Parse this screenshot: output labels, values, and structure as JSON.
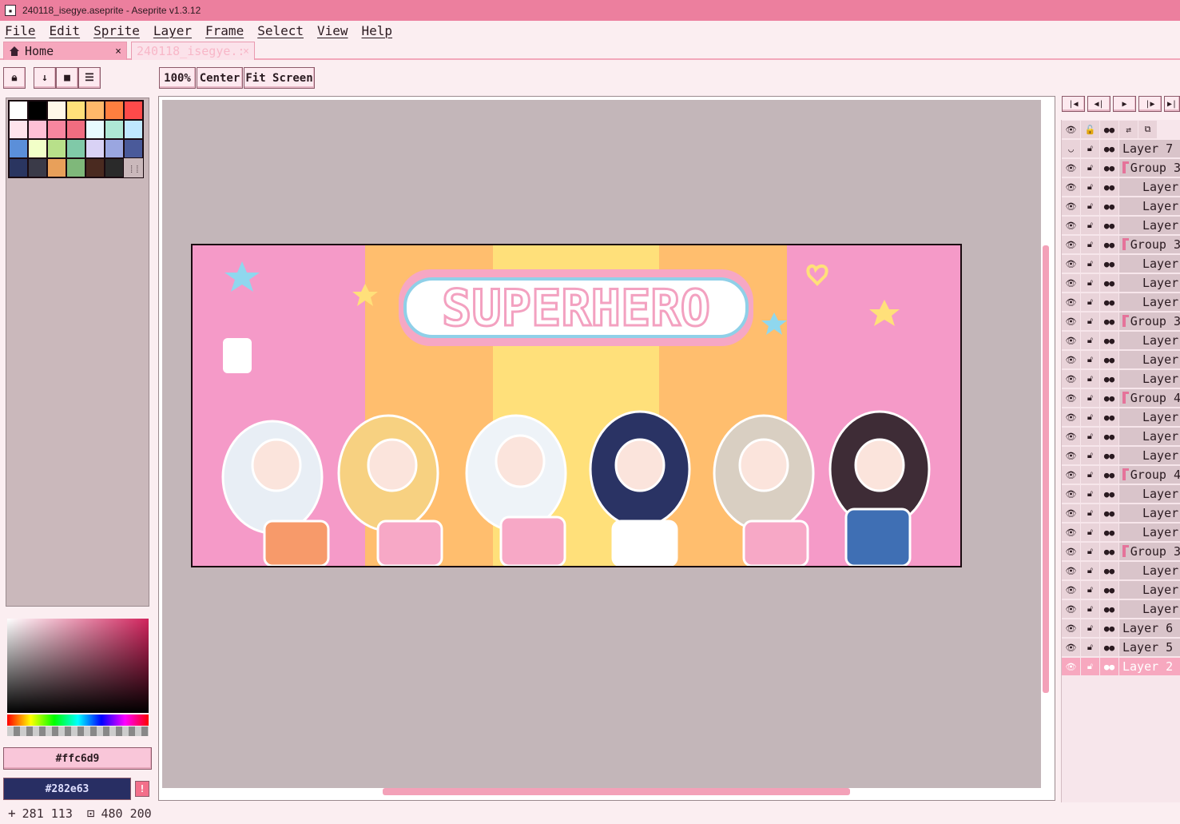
{
  "window": {
    "title": "240118_isegye.aseprite - Aseprite v1.3.12"
  },
  "menu": [
    "File",
    "Edit",
    "Sprite",
    "Layer",
    "Frame",
    "Select",
    "View",
    "Help"
  ],
  "tabs": [
    {
      "label": "Home",
      "close": "×"
    },
    {
      "label": "240118_isegye.:",
      "close": "×"
    }
  ],
  "toolbar": {
    "zoom_label": "100%",
    "center_label": "Center",
    "fit_label": "Fit Screen"
  },
  "palette": {
    "swatches": [
      "#ffffff",
      "#000000",
      "#fff8e8",
      "#ffe07a",
      "#ffb86a",
      "#ff7f3f",
      "#ff4a4a",
      "#ffe4ec",
      "#ffc0d6",
      "#f7869f",
      "#f06d80",
      "#e8fbff",
      "#aee8d5",
      "#bfe8ff",
      "#5b8fd9",
      "#f2ffc8",
      "#b8e08a",
      "#80c9a8",
      "#d9d2f5",
      "#9aa6e0",
      "#4a5a9a",
      "#2a3560",
      "#3a3a48",
      "#e8a05a",
      "#7fb87a",
      "#4a2a20",
      "#2a2a2a"
    ],
    "grip": "⁞⁞"
  },
  "colors": {
    "foreground_hex": "#ffc6d9",
    "background_hex": "#282e63",
    "warning": "!"
  },
  "status": {
    "cursor_icon": "+",
    "cursor_pos": "281 113",
    "size_icon": "⊡",
    "size": "480 200"
  },
  "timeline": {
    "buttons": [
      "|◀",
      "◀|",
      "▶",
      "|▶",
      "▶|"
    ],
    "header_icons": [
      "👁",
      "🔓",
      "●●",
      "⇄",
      "⧉"
    ],
    "layers": [
      {
        "name": "Layer 7",
        "type": "layer",
        "indent": false,
        "visible": false
      },
      {
        "name": "Group 3",
        "type": "group",
        "indent": false,
        "visible": true
      },
      {
        "name": "Layer",
        "type": "layer",
        "indent": true,
        "visible": true
      },
      {
        "name": "Layer",
        "type": "layer",
        "indent": true,
        "visible": true
      },
      {
        "name": "Layer",
        "type": "layer",
        "indent": true,
        "visible": true
      },
      {
        "name": "Group 3",
        "type": "group",
        "indent": false,
        "visible": true
      },
      {
        "name": "Layer",
        "type": "layer",
        "indent": true,
        "visible": true
      },
      {
        "name": "Layer",
        "type": "layer",
        "indent": true,
        "visible": true
      },
      {
        "name": "Layer",
        "type": "layer",
        "indent": true,
        "visible": true
      },
      {
        "name": "Group 3",
        "type": "group",
        "indent": false,
        "visible": true
      },
      {
        "name": "Layer",
        "type": "layer",
        "indent": true,
        "visible": true
      },
      {
        "name": "Layer",
        "type": "layer",
        "indent": true,
        "visible": true
      },
      {
        "name": "Layer",
        "type": "layer",
        "indent": true,
        "visible": true
      },
      {
        "name": "Group 4",
        "type": "group",
        "indent": false,
        "visible": true
      },
      {
        "name": "Layer",
        "type": "layer",
        "indent": true,
        "visible": true
      },
      {
        "name": "Layer",
        "type": "layer",
        "indent": true,
        "visible": true
      },
      {
        "name": "Layer",
        "type": "layer",
        "indent": true,
        "visible": true
      },
      {
        "name": "Group 4",
        "type": "group",
        "indent": false,
        "visible": true
      },
      {
        "name": "Layer",
        "type": "layer",
        "indent": true,
        "visible": true
      },
      {
        "name": "Layer",
        "type": "layer",
        "indent": true,
        "visible": true
      },
      {
        "name": "Layer",
        "type": "layer",
        "indent": true,
        "visible": true
      },
      {
        "name": "Group 3",
        "type": "group",
        "indent": false,
        "visible": true
      },
      {
        "name": "Layer",
        "type": "layer",
        "indent": true,
        "visible": true
      },
      {
        "name": "Layer",
        "type": "layer",
        "indent": true,
        "visible": true
      },
      {
        "name": "Layer",
        "type": "layer",
        "indent": true,
        "visible": true
      },
      {
        "name": "Layer 6",
        "type": "layer",
        "indent": false,
        "visible": true
      },
      {
        "name": "Layer 5",
        "type": "layer",
        "indent": false,
        "visible": true
      },
      {
        "name": "Layer 2",
        "type": "layer",
        "indent": false,
        "visible": true,
        "selected": true
      }
    ]
  },
  "sprite": {
    "title_text": "SUPERHERO",
    "stripe_colors": [
      "#f59ac8",
      "#ffbe6e",
      "#ffe07a",
      "#ffbe6e",
      "#f59ac8"
    ]
  }
}
